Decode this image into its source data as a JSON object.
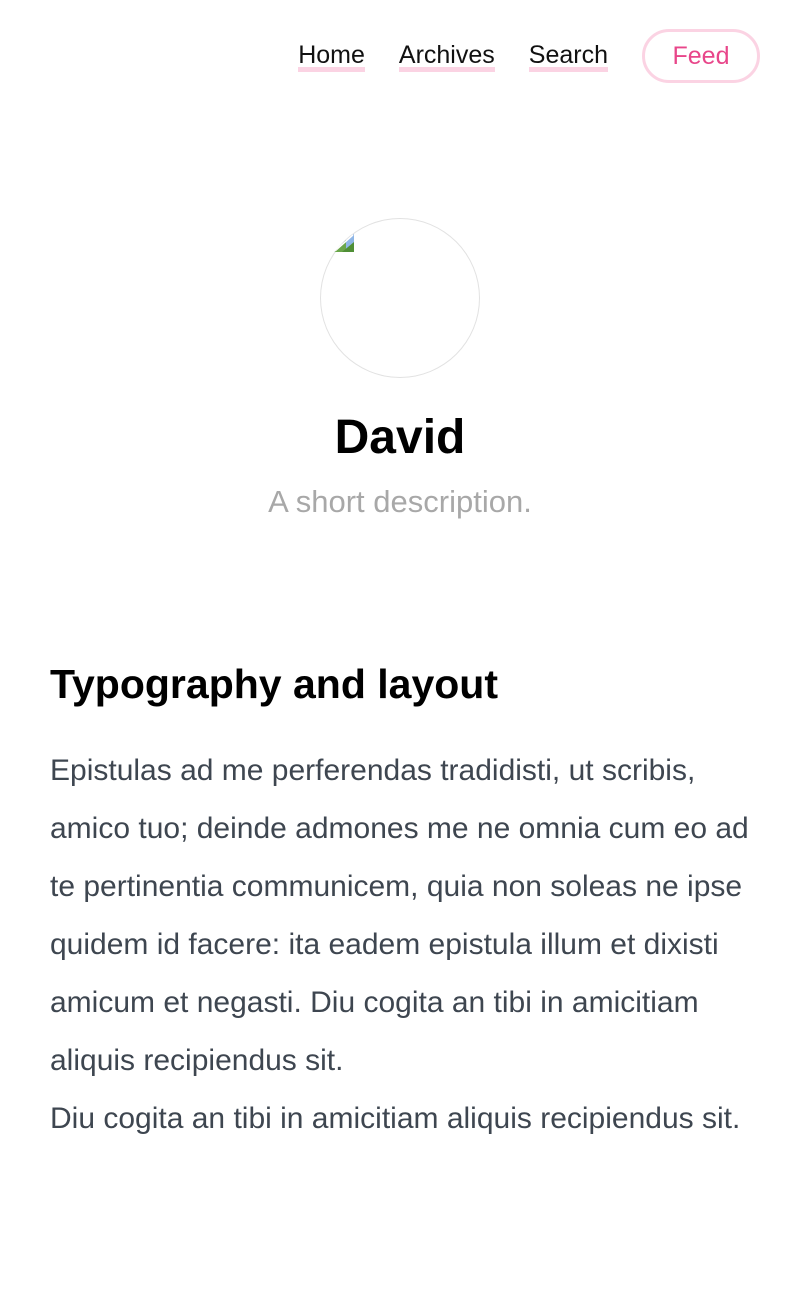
{
  "nav": {
    "items": [
      {
        "label": "Home"
      },
      {
        "label": "Archives"
      },
      {
        "label": "Search"
      }
    ],
    "feed_label": "Feed",
    "accent_color": "#e8468a",
    "underline_color": "#fbd3e3"
  },
  "profile": {
    "avatar_icon": "broken-image-icon",
    "name": "David",
    "description": "A short description."
  },
  "post": {
    "title": "Typography and layout",
    "paragraph_1": "Epistulas ad me perferendas tradidisti, ut scribis, amico tuo; deinde admones me ne omnia cum eo ad te pertinentia communicem, quia non soleas ne ipse quidem id facere: ita eadem epistula illum et dixisti amicum et negasti. Diu cogita an tibi in amicitiam aliquis recipiendus sit.",
    "paragraph_2": "Diu cogita an tibi in amicitiam aliquis recipiendus sit."
  }
}
